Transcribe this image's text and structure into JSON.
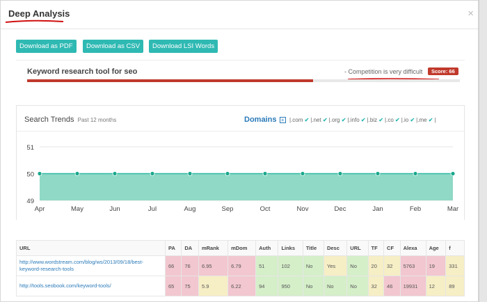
{
  "window": {
    "title": "Deep Analysis",
    "close_icon": "×"
  },
  "buttons": {
    "pdf": "Download as PDF",
    "csv": "Download as CSV",
    "lsi": "Download LSI Words"
  },
  "keyword": {
    "title": "Keyword research tool for seo",
    "competition": "- Competition is very difficult",
    "score_label": "Score: 66",
    "score": 66
  },
  "trends": {
    "title": "Search Trends",
    "subtitle": "Past 12 months",
    "domains_label": "Domains",
    "domains_plus": "+",
    "tlds": [
      ".com",
      ".net",
      ".org",
      ".info",
      ".biz",
      ".co",
      ".io",
      ".me"
    ],
    "check_icon": "check-icon",
    "accent_color": "#2fb9b3"
  },
  "chart_data": {
    "type": "area",
    "categories": [
      "Apr",
      "May",
      "Jun",
      "Jul",
      "Aug",
      "Sep",
      "Oct",
      "Nov",
      "Dec",
      "Jan",
      "Feb",
      "Mar"
    ],
    "values": [
      50,
      50,
      50,
      50,
      50,
      50,
      50,
      50,
      50,
      50,
      50,
      50
    ],
    "yticks": [
      51,
      50,
      49
    ],
    "ylim": [
      49,
      51
    ],
    "grid": true,
    "fill_color": "#8fd9c6",
    "line_color": "#2fb9a0",
    "point_color": "#1aa88c"
  },
  "table": {
    "headers": [
      "URL",
      "PA",
      "DA",
      "mRank",
      "mDom",
      "Auth",
      "Links",
      "Title",
      "Desc",
      "URL",
      "TF",
      "CF",
      "Alexa",
      "Age",
      "f"
    ],
    "rows": [
      {
        "cells": [
          "http://www.wordstream.com/blog/ws/2013/09/18/best-keyword-research-tools",
          "66",
          "76",
          "6.95",
          "6.79",
          "51",
          "102",
          "No",
          "Yes",
          "No",
          "20",
          "32",
          "5763",
          "19",
          "331"
        ],
        "colors": [
          "",
          "red",
          "red",
          "red",
          "red",
          "green",
          "green",
          "green",
          "yellow",
          "green",
          "yellow",
          "yellow",
          "red",
          "red",
          "yellow"
        ]
      },
      {
        "cells": [
          "http://tools.seobook.com/keyword-tools/",
          "65",
          "75",
          "5.9",
          "6.22",
          "94",
          "950",
          "No",
          "No",
          "No",
          "32",
          "46",
          "19931",
          "12",
          "89"
        ],
        "colors": [
          "",
          "red",
          "red",
          "yellow",
          "red",
          "green",
          "green",
          "green",
          "green",
          "green",
          "yellow",
          "red",
          "red",
          "yellow",
          "yellow"
        ]
      }
    ]
  }
}
